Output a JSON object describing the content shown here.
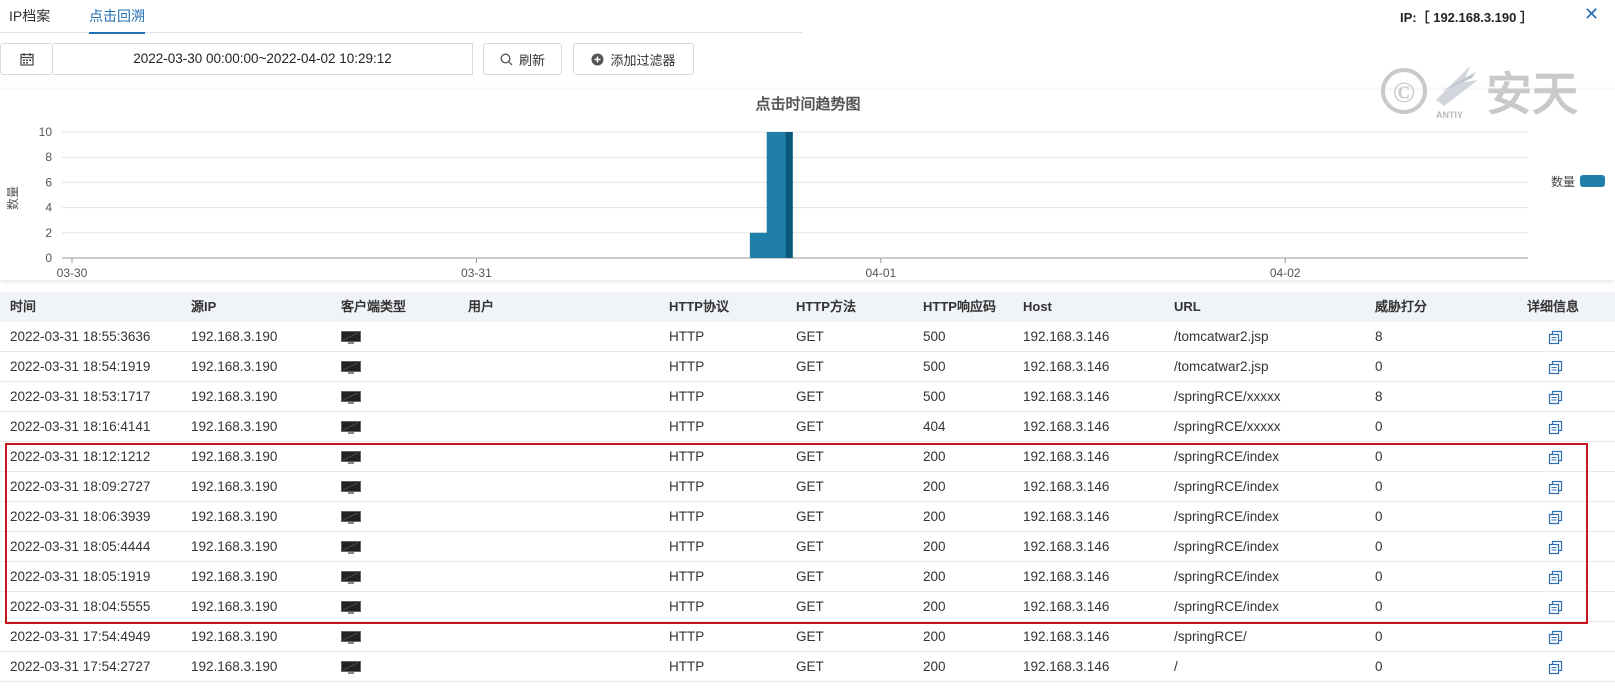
{
  "tabs": [
    {
      "label": "IP档案",
      "active": false
    },
    {
      "label": "点击回溯",
      "active": true
    }
  ],
  "ip_header": "IP:［ 192.168.3.190 ］",
  "toolbar": {
    "date_range": "2022-03-30 00:00:00~2022-04-02 10:29:12",
    "refresh_label": "刷新",
    "filter_label": "添加过滤器"
  },
  "watermark": {
    "text": "安天",
    "sub": "ANTIY",
    "symbol": "©"
  },
  "chart_data": {
    "type": "bar",
    "title": "点击时间趋势图",
    "ylabel": "数量",
    "legend": [
      "数量"
    ],
    "legend_position": "right",
    "series_color": "#1f7fa8",
    "ylim": [
      0,
      10
    ],
    "yticks": [
      0,
      2,
      4,
      6,
      8,
      10
    ],
    "xticks": [
      "03-30",
      "03-31",
      "04-01",
      "04-02"
    ],
    "x_range_hours": [
      0,
      87
    ],
    "x": [
      "2022-03-31 17:00",
      "2022-03-31 18:00"
    ],
    "values": [
      2,
      10
    ]
  },
  "table": {
    "headers": [
      "时间",
      "源IP",
      "客户端类型",
      "用户",
      "HTTP协议",
      "HTTP方法",
      "HTTP响应码",
      "Host",
      "URL",
      "威胁打分",
      "详细信息"
    ],
    "rows": [
      {
        "time": "2022-03-31 18:55:3636",
        "src": "192.168.3.190",
        "user": "",
        "proto": "HTTP",
        "method": "GET",
        "code": "500",
        "host": "192.168.3.146",
        "url": "/tomcatwar2.jsp",
        "score": "8"
      },
      {
        "time": "2022-03-31 18:54:1919",
        "src": "192.168.3.190",
        "user": "",
        "proto": "HTTP",
        "method": "GET",
        "code": "500",
        "host": "192.168.3.146",
        "url": "/tomcatwar2.jsp",
        "score": "0"
      },
      {
        "time": "2022-03-31 18:53:1717",
        "src": "192.168.3.190",
        "user": "",
        "proto": "HTTP",
        "method": "GET",
        "code": "500",
        "host": "192.168.3.146",
        "url": "/springRCE/xxxxx",
        "score": "8"
      },
      {
        "time": "2022-03-31 18:16:4141",
        "src": "192.168.3.190",
        "user": "",
        "proto": "HTTP",
        "method": "GET",
        "code": "404",
        "host": "192.168.3.146",
        "url": "/springRCE/xxxxx",
        "score": "0"
      },
      {
        "time": "2022-03-31 18:12:1212",
        "src": "192.168.3.190",
        "user": "",
        "proto": "HTTP",
        "method": "GET",
        "code": "200",
        "host": "192.168.3.146",
        "url": "/springRCE/index",
        "score": "0"
      },
      {
        "time": "2022-03-31 18:09:2727",
        "src": "192.168.3.190",
        "user": "",
        "proto": "HTTP",
        "method": "GET",
        "code": "200",
        "host": "192.168.3.146",
        "url": "/springRCE/index",
        "score": "0"
      },
      {
        "time": "2022-03-31 18:06:3939",
        "src": "192.168.3.190",
        "user": "",
        "proto": "HTTP",
        "method": "GET",
        "code": "200",
        "host": "192.168.3.146",
        "url": "/springRCE/index",
        "score": "0"
      },
      {
        "time": "2022-03-31 18:05:4444",
        "src": "192.168.3.190",
        "user": "",
        "proto": "HTTP",
        "method": "GET",
        "code": "200",
        "host": "192.168.3.146",
        "url": "/springRCE/index",
        "score": "0"
      },
      {
        "time": "2022-03-31 18:05:1919",
        "src": "192.168.3.190",
        "user": "",
        "proto": "HTTP",
        "method": "GET",
        "code": "200",
        "host": "192.168.3.146",
        "url": "/springRCE/index",
        "score": "0"
      },
      {
        "time": "2022-03-31 18:04:5555",
        "src": "192.168.3.190",
        "user": "",
        "proto": "HTTP",
        "method": "GET",
        "code": "200",
        "host": "192.168.3.146",
        "url": "/springRCE/index",
        "score": "0"
      },
      {
        "time": "2022-03-31 17:54:4949",
        "src": "192.168.3.190",
        "user": "",
        "proto": "HTTP",
        "method": "GET",
        "code": "200",
        "host": "192.168.3.146",
        "url": "/springRCE/",
        "score": "0"
      },
      {
        "time": "2022-03-31 17:54:2727",
        "src": "192.168.3.190",
        "user": "",
        "proto": "HTTP",
        "method": "GET",
        "code": "200",
        "host": "192.168.3.146",
        "url": "/",
        "score": "0"
      }
    ]
  },
  "icons": {
    "calendar": "calendar-icon",
    "refresh": "search-icon",
    "filter": "plus-circle-icon",
    "client": "monitor-icon",
    "detail": "copy-icon",
    "close": "close-icon"
  }
}
